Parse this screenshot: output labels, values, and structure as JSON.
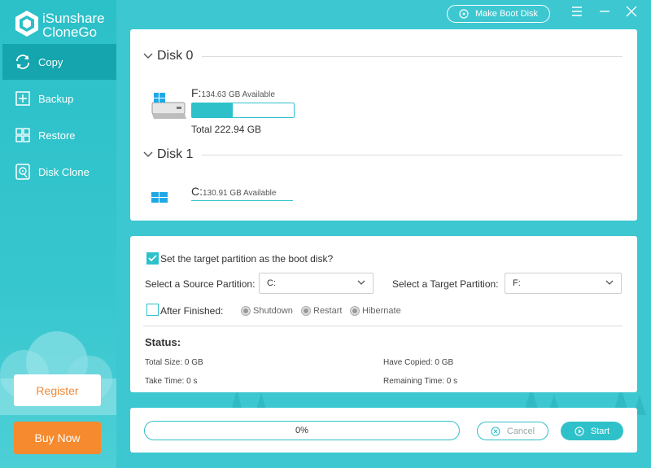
{
  "app": {
    "name_line1": "iSunshare",
    "name_line2": "CloneGo"
  },
  "colors": {
    "accent": "#2fc1ca",
    "sidebar_active": "#14a5ae",
    "buy_now": "#f58a2e",
    "register_text": "#f08a33"
  },
  "sidebar": {
    "items": [
      {
        "label": "Copy",
        "icon": "refresh-icon",
        "active": true
      },
      {
        "label": "Backup",
        "icon": "backup-icon",
        "active": false
      },
      {
        "label": "Restore",
        "icon": "restore-icon",
        "active": false
      },
      {
        "label": "Disk Clone",
        "icon": "disk-clone-icon",
        "active": false
      }
    ],
    "register_label": "Register",
    "buy_label": "Buy Now"
  },
  "titlebar": {
    "boot_disk_label": "Make Boot Disk"
  },
  "disks": [
    {
      "label": "Disk 0",
      "partitions": [
        {
          "letter": "F:",
          "available": "134.63 GB Available",
          "total": "Total 222.94 GB",
          "used_fraction": 0.4
        }
      ]
    },
    {
      "label": "Disk 1",
      "partitions": [
        {
          "letter": "C:",
          "available": "130.91 GB Available"
        }
      ]
    }
  ],
  "settings": {
    "boot_disk_label": "Set the target partition as the boot disk?",
    "boot_disk_checked": true,
    "source_label": "Select a Source Partition:",
    "source_value": "C:",
    "target_label": "Select a Target Partition:",
    "target_value": "F:",
    "after_finished_label": "After Finished:",
    "after_finished_checked": false,
    "options": [
      "Shutdown",
      "Restart",
      "Hibernate"
    ]
  },
  "status": {
    "title": "Status:",
    "total_size": "Total Size: 0 GB",
    "have_copied": "Have Copied: 0 GB",
    "take_time": "Take Time: 0 s",
    "remaining_time": "Remaining Time: 0 s"
  },
  "progress": {
    "percent_text": "0%",
    "percent_value": 0,
    "cancel_label": "Cancel",
    "start_label": "Start"
  }
}
